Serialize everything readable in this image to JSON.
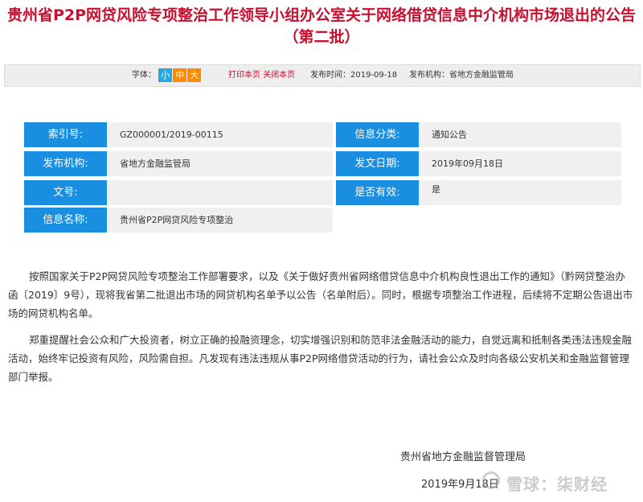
{
  "title": {
    "line1": "贵州省P2P网贷风险专项整治工作领导小组办公室关于网络借贷信息中介机构市场退出的公告",
    "line2": "（第二批）"
  },
  "toolbar": {
    "font_label": "字体：",
    "font_small": "小",
    "font_medium": "中",
    "font_large": "大",
    "print": "打印本页",
    "close": "关闭本页",
    "publish_time": "发布时间：2019-09-18",
    "publisher": "发布机构：省地方金融监管局"
  },
  "info": {
    "index_label": "索引号:",
    "index_value": "GZ000001/2019-00115",
    "category_label": "信息分类:",
    "category_value": "通知公告",
    "org_label": "发布机构:",
    "org_value": "省地方金融监管局",
    "date_label": "发文日期:",
    "date_value": "2019年09月18日",
    "docno_label": "文号:",
    "docno_value": "",
    "valid_label": "是否有效:",
    "valid_value": "是",
    "name_label": "信息名称:",
    "name_value": "贵州省P2P网贷风险专项整治"
  },
  "body": {
    "p1": "按照国家关于P2P网贷风险专项整治工作部署要求，以及《关于做好贵州省网络借贷信息中介机构良性退出工作的通知》（黔网贷整治办函〔2019〕9号），现将我省第二批退出市场的网贷机构名单予以公告（名单附后）。同时，根据专项整治工作进程，后续将不定期公告退出市场的网贷机构名单。",
    "p2": "郑重提醒社会公众和广大投资者，树立正确的投融资理念，切实增强识别和防范非法金融活动的能力，自觉远离和抵制各类违法违规金融活动，始终牢记投资有风险，风险需自担。凡发现有违法违规从事P2P网络借贷活动的行为，请社会公众及时向各级公安机关和金融监督管理部门举报。"
  },
  "signature": {
    "org": "贵州省地方金融监督管理局",
    "date": "2019年9月18日"
  },
  "watermark": "雪球：柒财经"
}
